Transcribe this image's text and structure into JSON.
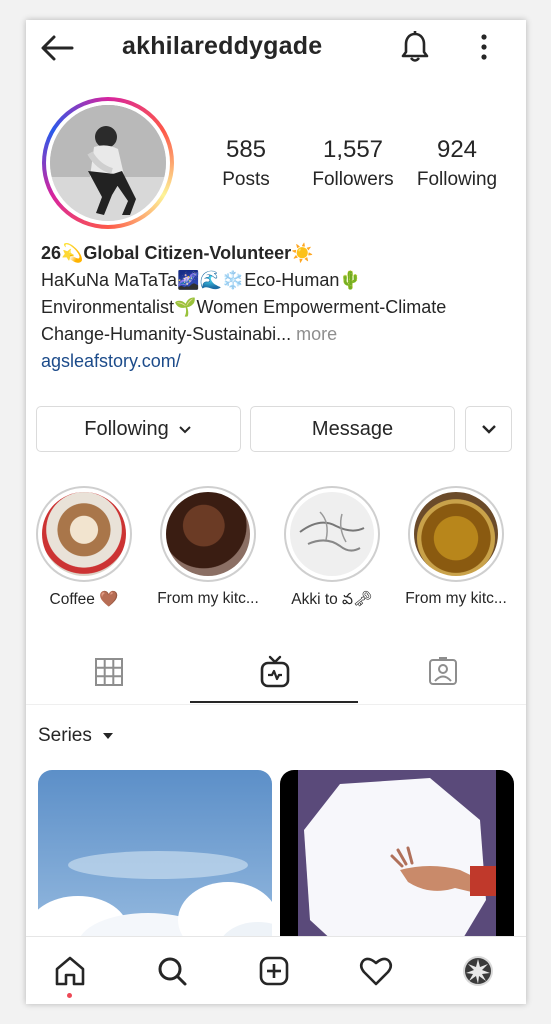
{
  "header": {
    "username": "akhilareddygade",
    "back_icon": "arrow-left-icon",
    "notification_icon": "bell-icon",
    "menu_icon": "kebab-menu-icon"
  },
  "stats": [
    {
      "value": "585",
      "label": "Posts"
    },
    {
      "value": "1,557",
      "label": "Followers"
    },
    {
      "value": "924",
      "label": "Following"
    }
  ],
  "bio": {
    "line1": "26💫Global Citizen-Volunteer☀️",
    "line2": "HaKuNa MaTaTa🌌🌊❄️Eco-Human🌵",
    "line3": "Environmentalist🌱Women Empowerment-Climate",
    "line4": "Change-Humanity-Sustainabi...",
    "more": " more",
    "link": "agsleafstory.com/"
  },
  "actions": {
    "following_label": "Following",
    "message_label": "Message"
  },
  "highlights": [
    {
      "label": "Coffee 🤎"
    },
    {
      "label": "From my kitc..."
    },
    {
      "label": "Akki to వ🗝"
    },
    {
      "label": "From my kitc..."
    }
  ],
  "tabs": {
    "grid_icon": "grid-icon",
    "igtv_icon": "igtv-icon",
    "tagged_icon": "tagged-icon",
    "active": "igtv"
  },
  "series": {
    "label": "Series"
  },
  "bottom_nav": {
    "items": [
      "home-icon",
      "search-icon",
      "add-post-icon",
      "heart-icon",
      "profile-avatar"
    ],
    "notification_dot_color": "#ed4956"
  },
  "colors": {
    "link": "#1c4b8a",
    "muted": "#8e8e8e",
    "text": "#262626"
  }
}
